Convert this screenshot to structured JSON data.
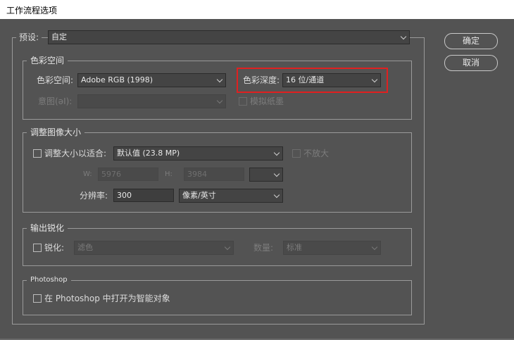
{
  "window": {
    "title": "工作流程选项"
  },
  "buttons": {
    "ok": "确定",
    "cancel": "取消"
  },
  "preset": {
    "label": "预设:",
    "value": "自定"
  },
  "color_group": {
    "title": "色彩空间",
    "space_label": "色彩空间:",
    "space_value": "Adobe RGB (1998)",
    "depth_label": "色彩深度:",
    "depth_value": "16 位/通道",
    "intent_label": "意图(əI):",
    "intent_value": "",
    "simulate_label": "模拟纸墨"
  },
  "resize_group": {
    "title": "调整图像大小",
    "fit_label": "调整大小以适合:",
    "fit_value": "默认值 (23.8 MP)",
    "no_enlarge_label": "不放大",
    "w_label": "W:",
    "w_value": "5976",
    "h_label": "H:",
    "h_value": "3984",
    "unit_value": "",
    "resolution_label": "分辨率:",
    "resolution_value": "300",
    "resolution_unit": "像素/英寸"
  },
  "sharpen_group": {
    "title": "输出锐化",
    "sharpen_label": "锐化:",
    "sharpen_value": "滤色",
    "amount_label": "数量:",
    "amount_value": "标准"
  },
  "photoshop_group": {
    "title": "Photoshop",
    "smart_object_label": "在 Photoshop 中打开为智能对象"
  },
  "colors": {
    "background": "#535353",
    "highlight": "#e02020"
  }
}
